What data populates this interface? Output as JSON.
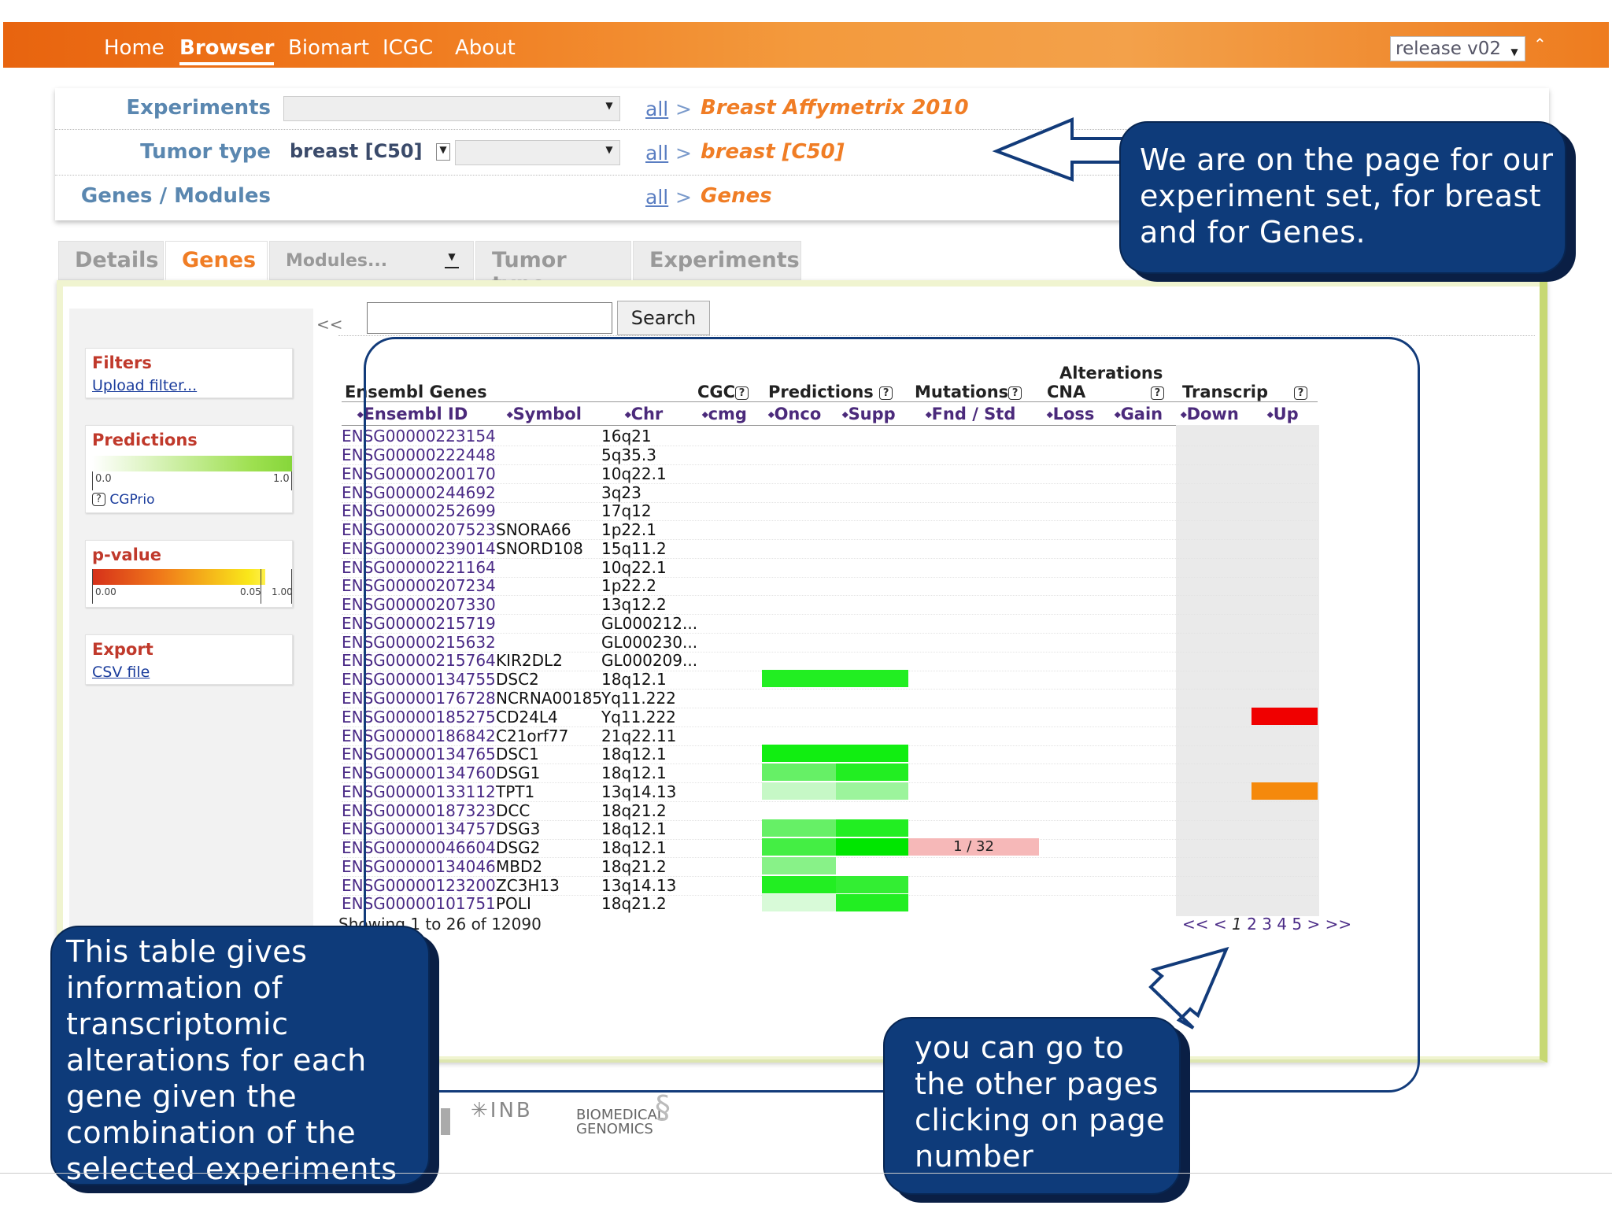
{
  "nav": {
    "items": [
      "Home",
      "Browser",
      "Biomart",
      "ICGC",
      "About"
    ],
    "active": "Browser",
    "release": "release v02"
  },
  "selector": {
    "experiments": {
      "label": "Experiments",
      "all": "all",
      "sep": ">",
      "value": "Breast Affymetrix 2010"
    },
    "tumor": {
      "label": "Tumor type",
      "combo_value": "breast [C50]",
      "all": "all",
      "sep": ">",
      "value": "breast [C50]"
    },
    "genes": {
      "label": "Genes / Modules",
      "all": "all",
      "sep": ">",
      "value": "Genes"
    }
  },
  "tabs": [
    "Details",
    "Genes",
    "Modules...",
    "Tumor type",
    "Experiments"
  ],
  "active_tab": "Genes",
  "search": {
    "collapse": "<<",
    "button": "Search",
    "value": ""
  },
  "left": {
    "filters_title": "Filters",
    "upload_link": "Upload filter...",
    "predictions_title": "Predictions",
    "pred_min": "0.0",
    "pred_max": "1.0",
    "cgprio": "CGPrio",
    "pvalue_title": "p-value",
    "pv_a": "0.00",
    "pv_b": "0.05",
    "pv_c": "1.00",
    "export_title": "Export",
    "csv_link": "CSV file"
  },
  "table": {
    "alterations": "Alterations",
    "ensembl_genes": "Ensembl Genes",
    "cgc": "CGC",
    "predictions": "Predictions",
    "mutations": "Mutations",
    "cna": "CNA",
    "transcrip": "Transcrip",
    "col_id": "Ensembl ID",
    "col_symbol": "Symbol",
    "col_chr": "Chr",
    "col_cmg": "cmg",
    "col_onco": "Onco",
    "col_supp": "Supp",
    "col_fnd": "Fnd / Std",
    "col_loss": "Loss",
    "col_gain": "Gain",
    "col_down": "Down",
    "col_up": "Up",
    "rows": [
      {
        "id": "ENSG00000223154",
        "symbol": "",
        "chr": "16q21"
      },
      {
        "id": "ENSG00000222448",
        "symbol": "",
        "chr": "5q35.3"
      },
      {
        "id": "ENSG00000200170",
        "symbol": "",
        "chr": "10q22.1"
      },
      {
        "id": "ENSG00000244692",
        "symbol": "",
        "chr": "3q23"
      },
      {
        "id": "ENSG00000252699",
        "symbol": "",
        "chr": "17q12"
      },
      {
        "id": "ENSG00000207523",
        "symbol": "SNORA66",
        "chr": "1p22.1"
      },
      {
        "id": "ENSG00000239014",
        "symbol": "SNORD108",
        "chr": "15q11.2"
      },
      {
        "id": "ENSG00000221164",
        "symbol": "",
        "chr": "10q22.1"
      },
      {
        "id": "ENSG00000207234",
        "symbol": "",
        "chr": "1p22.2"
      },
      {
        "id": "ENSG00000207330",
        "symbol": "",
        "chr": "13q12.2"
      },
      {
        "id": "ENSG00000215719",
        "symbol": "",
        "chr": "GL000212..."
      },
      {
        "id": "ENSG00000215632",
        "symbol": "",
        "chr": "GL000230..."
      },
      {
        "id": "ENSG00000215764",
        "symbol": "KIR2DL2",
        "chr": "GL000209..."
      },
      {
        "id": "ENSG00000134755",
        "symbol": "DSC2",
        "chr": "18q12.1"
      },
      {
        "id": "ENSG00000176728",
        "symbol": "NCRNA00185",
        "chr": "Yq11.222"
      },
      {
        "id": "ENSG00000185275",
        "symbol": "CD24L4",
        "chr": "Yq11.222"
      },
      {
        "id": "ENSG00000186842",
        "symbol": "C21orf77",
        "chr": "21q22.11"
      },
      {
        "id": "ENSG00000134765",
        "symbol": "DSC1",
        "chr": "18q12.1"
      },
      {
        "id": "ENSG00000134760",
        "symbol": "DSG1",
        "chr": "18q12.1"
      },
      {
        "id": "ENSG00000133112",
        "symbol": "TPT1",
        "chr": "13q14.13"
      },
      {
        "id": "ENSG00000187323",
        "symbol": "DCC",
        "chr": "18q21.2"
      },
      {
        "id": "ENSG00000134757",
        "symbol": "DSG3",
        "chr": "18q12.1"
      },
      {
        "id": "ENSG00000046604",
        "symbol": "DSG2",
        "chr": "18q12.1"
      },
      {
        "id": "ENSG00000134046",
        "symbol": "MBD2",
        "chr": "18q21.2"
      },
      {
        "id": "ENSG00000123200",
        "symbol": "ZC3H13",
        "chr": "13q14.13"
      },
      {
        "id": "ENSG00000101751",
        "symbol": "POLI",
        "chr": "18q21.2"
      }
    ],
    "mutation_label": "1 / 32",
    "showing": "Showing 1 to 26 of 12090",
    "pager": [
      "<<",
      "<",
      "1",
      "2",
      "3",
      "4",
      "5",
      ">",
      ">>"
    ]
  },
  "colors": {
    "header": "#ee7c1f",
    "pred_strong": "#22ee22",
    "pred_mid": "#66f066",
    "pred_light": "#c6f8c6",
    "trans_up_red": "#f00000",
    "trans_up_orange": "#f5890c",
    "mutation_pink": "#f6b8b8",
    "callout": "#0e3b7a"
  },
  "callouts": {
    "top": "We are on the page for our experiment set, for breast and for Genes.",
    "bottom_left": "This table gives information of transcriptomic alterations for each gene given the combination of the selected experiments",
    "bottom_right": "you can go to the other pages clicking on page number"
  },
  "logos": {
    "inb": "INB",
    "bio_line1": "BIOMEDICAL",
    "bio_line2": "GENOMICS"
  }
}
